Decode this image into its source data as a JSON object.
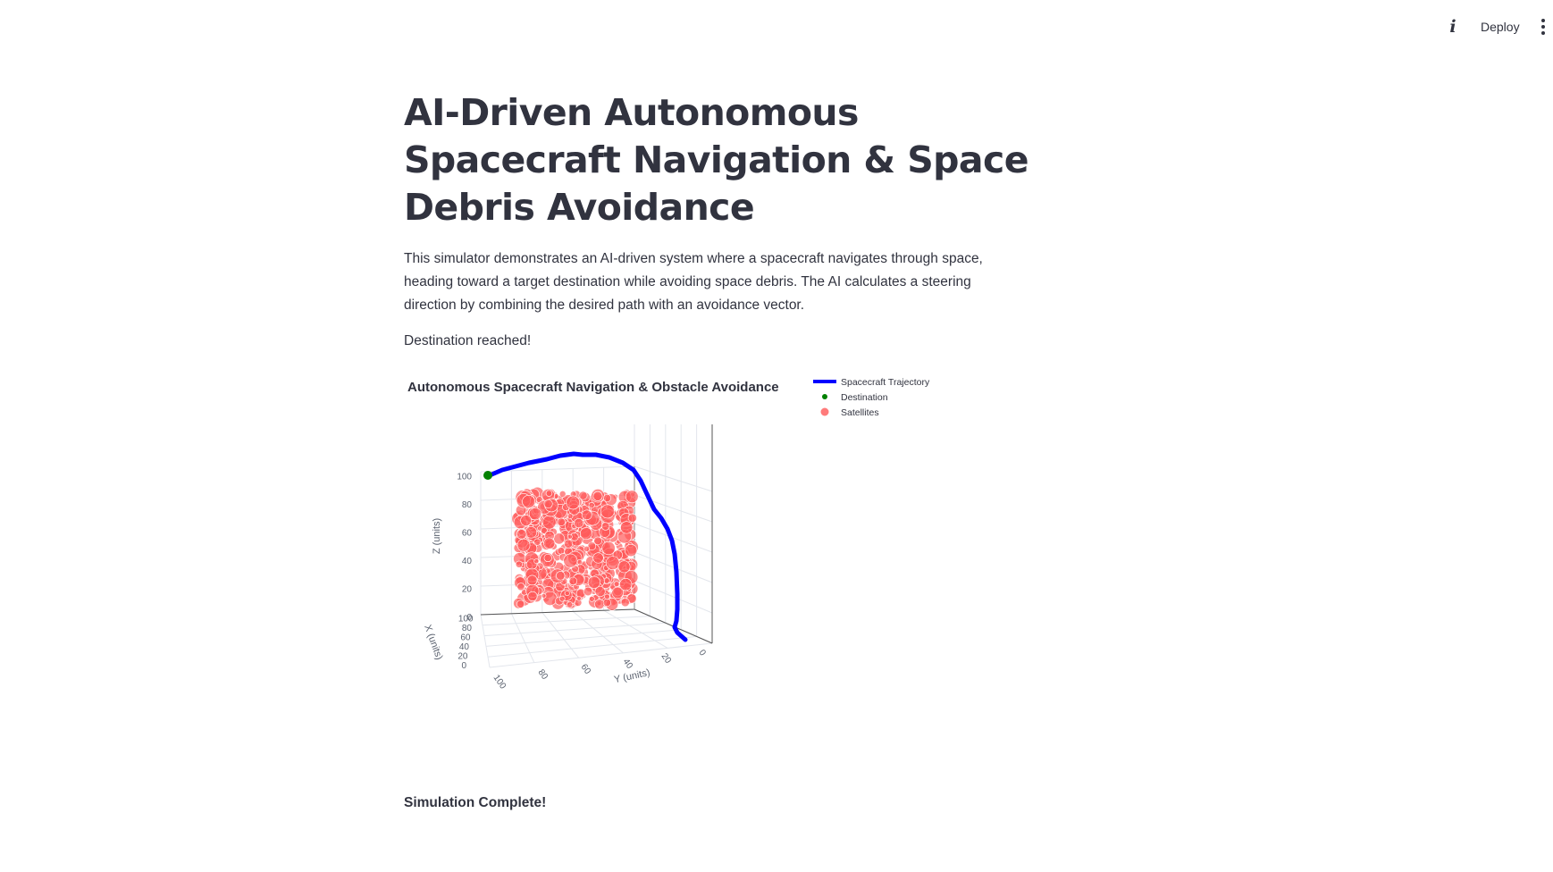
{
  "header": {
    "info_icon": "info-icon",
    "deploy_label": "Deploy",
    "menu_icon": "vertical-dots-icon"
  },
  "main": {
    "title": "AI-Driven Autonomous Spacecraft Navigation & Space Debris Avoidance",
    "description": "This simulator demonstrates an AI-driven system where a spacecraft navigates through space, heading toward a target destination while avoiding space debris. The AI calculates a steering direction by combining the desired path with an avoidance vector.",
    "status": "Destination reached!",
    "complete": "Simulation Complete!"
  },
  "chart_data": {
    "type": "scatter",
    "title": "Autonomous Spacecraft Navigation & Obstacle Avoidance",
    "legend_position": "top-right",
    "axes": {
      "x": {
        "label": "X (units)",
        "range": [
          0,
          100
        ],
        "ticks": [
          "0",
          "20",
          "40",
          "60",
          "80",
          "100"
        ]
      },
      "y": {
        "label": "Y (units)",
        "range": [
          0,
          100
        ],
        "ticks": [
          "100",
          "80",
          "60",
          "40",
          "20",
          "0"
        ]
      },
      "z": {
        "label": "Z (units)",
        "range": [
          0,
          100
        ],
        "ticks": [
          "0",
          "20",
          "40",
          "60",
          "80",
          "100"
        ]
      }
    },
    "grid": true,
    "series": [
      {
        "name": "Spacecraft Trajectory",
        "kind": "line3d",
        "color": "#0000ff"
      },
      {
        "name": "Destination",
        "kind": "marker",
        "color": "#008000"
      },
      {
        "name": "Satellites",
        "kind": "markers",
        "color": "#ff5a5a",
        "count_approx": 500
      }
    ]
  }
}
